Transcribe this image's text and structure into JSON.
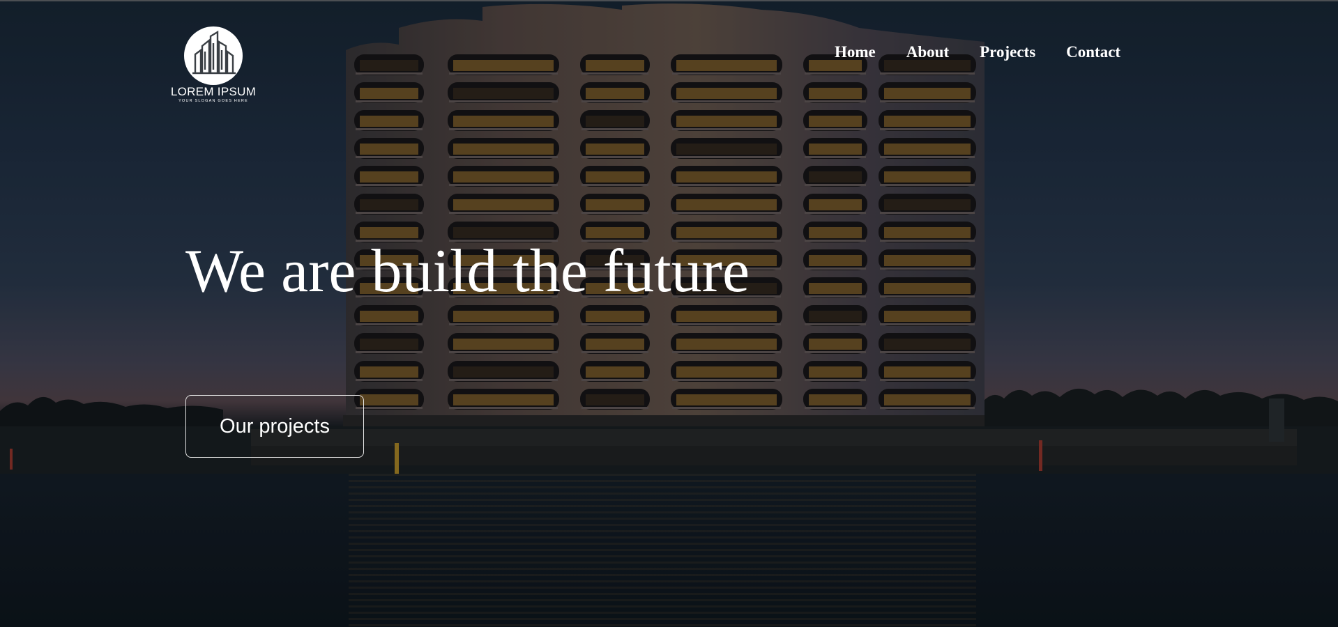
{
  "brand": {
    "name": "LOREM IPSUM",
    "slogan": "YOUR SLOGAN GOES HERE",
    "icon": "building-logo-icon"
  },
  "nav": {
    "items": [
      {
        "label": "Home"
      },
      {
        "label": "About"
      },
      {
        "label": "Projects"
      },
      {
        "label": "Contact"
      }
    ]
  },
  "hero": {
    "headline": "We are build the future",
    "cta_label": "Our projects",
    "background": "night-apartment-building-waterfront-photo"
  },
  "colors": {
    "text": "#ffffff",
    "button_border": "#e8e8e8",
    "window_glow": "#c9923a"
  }
}
